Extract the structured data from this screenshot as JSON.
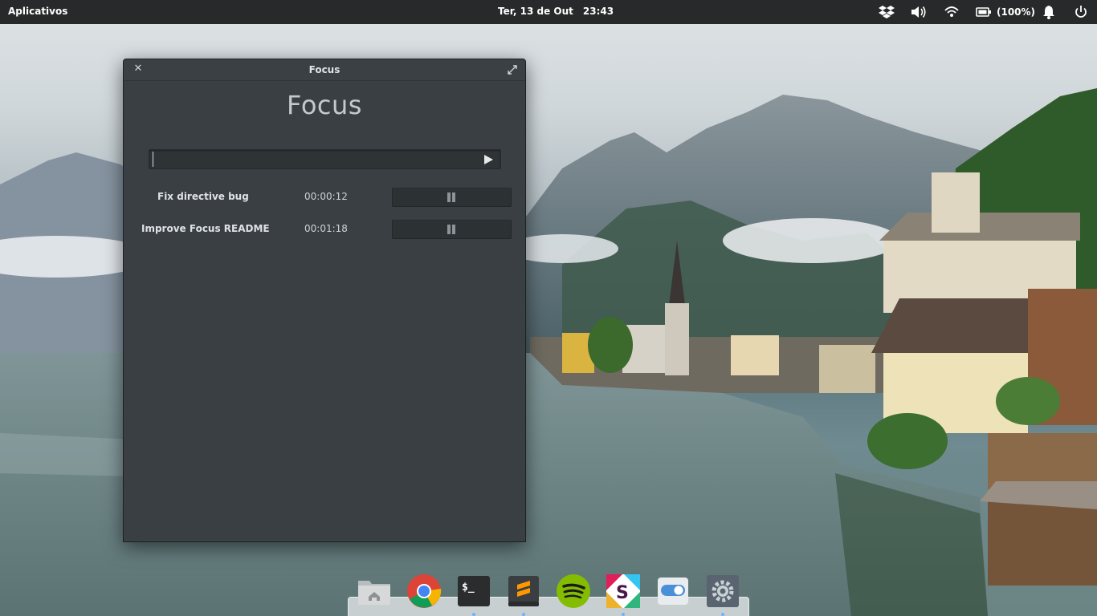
{
  "top_panel": {
    "apps_menu_label": "Aplicativos",
    "date": "Ter, 13 de Out",
    "time": "23:43",
    "battery_percent": "(100%)",
    "indicators": [
      "dropbox-icon",
      "volume-icon",
      "wifi-icon",
      "battery-icon",
      "notifications-icon",
      "power-icon"
    ]
  },
  "window": {
    "title": "Focus",
    "heading": "Focus",
    "task_input": {
      "value": "",
      "placeholder": ""
    },
    "tasks": [
      {
        "name": "Fix directive bug",
        "time": "00:00:12"
      },
      {
        "name": "Improve Focus README",
        "time": "00:01:18"
      }
    ]
  },
  "dock": {
    "items": [
      "files-icon",
      "chrome-icon",
      "terminal-icon",
      "sublime-text-icon",
      "spotify-icon",
      "slack-icon",
      "switchboard-toggle-icon",
      "settings-icon"
    ],
    "running": [
      "terminal-icon",
      "sublime-text-icon",
      "slack-icon",
      "settings-icon"
    ]
  },
  "colors": {
    "panel_bg": "#000000",
    "window_bg": "#393f43",
    "accent_dot": "#6db2ff"
  }
}
